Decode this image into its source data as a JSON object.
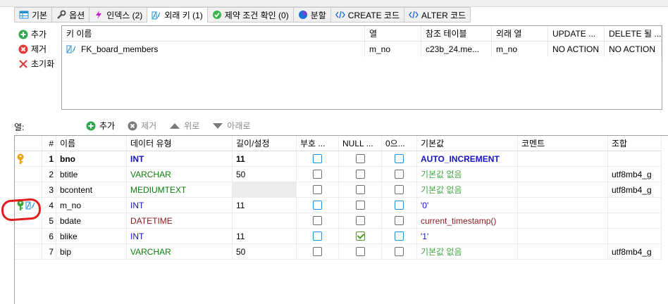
{
  "tabs": [
    {
      "label": "기본",
      "icon": "table-icon"
    },
    {
      "label": "옵션",
      "icon": "wrench-icon"
    },
    {
      "label": "인덱스 (2)",
      "icon": "lightning-icon"
    },
    {
      "label": "외래 키 (1)",
      "icon": "foreign-key-icon",
      "active": true
    },
    {
      "label": "제약 조건 확인 (0)",
      "icon": "check-icon"
    },
    {
      "label": "분할",
      "icon": "pie-icon"
    },
    {
      "label": "CREATE 코드",
      "icon": "code-icon"
    },
    {
      "label": "ALTER 코드",
      "icon": "code-icon"
    }
  ],
  "fk_actions": {
    "add": "추가",
    "remove": "제거",
    "reset": "초기화"
  },
  "fk_table": {
    "headers": [
      "키 이름",
      "열",
      "참조 테이블",
      "외래 열",
      "UPDATE ...",
      "DELETE 될 ..."
    ],
    "rows": [
      {
        "name": "FK_board_members",
        "column": "m_no",
        "ref_table": "c23b_24.me...",
        "foreign_column": "m_no",
        "on_update": "NO ACTION",
        "on_delete": "NO ACTION"
      }
    ]
  },
  "columns_section": {
    "label": "열:",
    "toolbar": {
      "add": "추가",
      "remove": "제거",
      "up": "위로",
      "down": "아래로"
    }
  },
  "columns_table": {
    "headers": [
      "#",
      "이름",
      "데이터 유형",
      "길이/설정",
      "부호 ...",
      "NULL ...",
      "0으...",
      "기본값",
      "코멘트",
      "조합"
    ],
    "rows": [
      {
        "num": "1",
        "name": "bno",
        "type": "INT",
        "length": "11",
        "unsigned": false,
        "nullable": false,
        "zerofill": false,
        "default": "AUTO_INCREMENT",
        "comment": "",
        "collation": "",
        "key": "primary"
      },
      {
        "num": "2",
        "name": "btitle",
        "type": "VARCHAR",
        "length": "50",
        "unsigned": false,
        "nullable": false,
        "zerofill": false,
        "default": "기본값 없음",
        "comment": "",
        "collation": "utf8mb4_g",
        "key": ""
      },
      {
        "num": "3",
        "name": "bcontent",
        "type": "MEDIUMTEXT",
        "length": "",
        "unsigned": false,
        "nullable": false,
        "zerofill": false,
        "default": "기본값 없음",
        "comment": "",
        "collation": "utf8mb4_g",
        "key": ""
      },
      {
        "num": "4",
        "name": "m_no",
        "type": "INT",
        "length": "11",
        "unsigned": false,
        "nullable": false,
        "zerofill": false,
        "default": "'0'",
        "comment": "",
        "collation": "",
        "key": "index+foreign"
      },
      {
        "num": "5",
        "name": "bdate",
        "type": "DATETIME",
        "length": "",
        "unsigned": false,
        "nullable": false,
        "zerofill": false,
        "default": "current_timestamp()",
        "comment": "",
        "collation": "",
        "key": ""
      },
      {
        "num": "6",
        "name": "blike",
        "type": "INT",
        "length": "11",
        "unsigned": false,
        "nullable": true,
        "zerofill": false,
        "default": "'1'",
        "comment": "",
        "collation": "",
        "key": ""
      },
      {
        "num": "7",
        "name": "bip",
        "type": "VARCHAR",
        "length": "50",
        "unsigned": false,
        "nullable": false,
        "zerofill": false,
        "default": "기본값 없음",
        "comment": "",
        "collation": "utf8mb4_g",
        "key": ""
      }
    ]
  },
  "colors": {
    "accent_blue": "#1f8fd6",
    "type_blue": "#1515c8",
    "type_green": "#0a7d0a",
    "type_red": "#8b1a1a",
    "default_green": "#44aa44",
    "annotation_red": "#e21b1b"
  }
}
